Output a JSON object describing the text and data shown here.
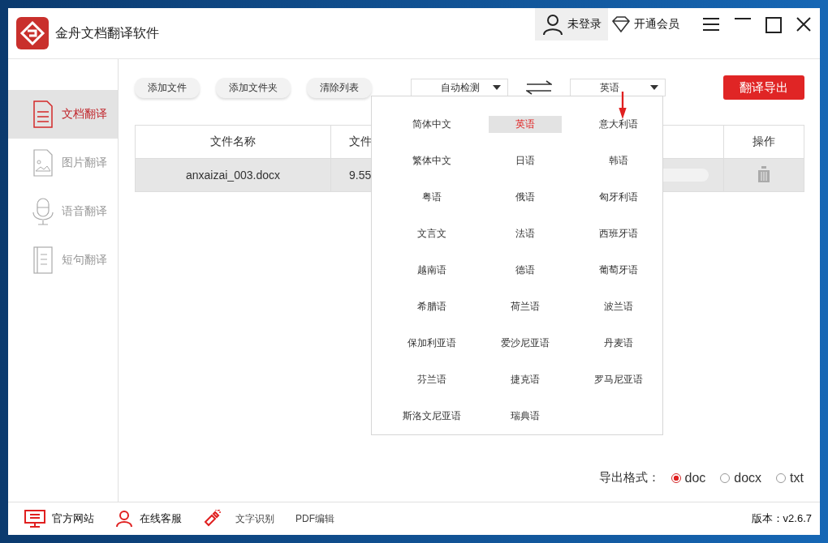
{
  "window": {
    "title": "金舟文档翻译软件"
  },
  "header": {
    "user": "未登录",
    "vip": "开通会员"
  },
  "sidebar": {
    "items": [
      {
        "label": "文档翻译",
        "kind": "doc",
        "selected": true
      },
      {
        "label": "图片翻译",
        "kind": "image",
        "selected": false
      },
      {
        "label": "语音翻译",
        "kind": "voice",
        "selected": false
      },
      {
        "label": "短句翻译",
        "kind": "sentence",
        "selected": false
      }
    ]
  },
  "toolbar": {
    "buttons": [
      "添加文件",
      "添加文件夹",
      "清除列表"
    ],
    "source_language": "自动检测",
    "target_language": "英语",
    "export_button": "翻译导出"
  },
  "table": {
    "columns": [
      "文件名称",
      "文件",
      "操作"
    ],
    "rows": [
      {
        "name": "anxaizai_003.docx",
        "size": "9.55"
      }
    ]
  },
  "language_menu": {
    "items": [
      {
        "label": "简体中文",
        "selected": false
      },
      {
        "label": "英语",
        "selected": true
      },
      {
        "label": "意大利语",
        "selected": false
      },
      {
        "label": "繁体中文",
        "selected": false
      },
      {
        "label": "日语",
        "selected": false
      },
      {
        "label": "韩语",
        "selected": false
      },
      {
        "label": "粤语",
        "selected": false
      },
      {
        "label": "俄语",
        "selected": false
      },
      {
        "label": "匈牙利语",
        "selected": false
      },
      {
        "label": "文言文",
        "selected": false
      },
      {
        "label": "法语",
        "selected": false
      },
      {
        "label": "西班牙语",
        "selected": false
      },
      {
        "label": "越南语",
        "selected": false
      },
      {
        "label": "德语",
        "selected": false
      },
      {
        "label": "葡萄牙语",
        "selected": false
      },
      {
        "label": "希腊语",
        "selected": false
      },
      {
        "label": "荷兰语",
        "selected": false
      },
      {
        "label": "波兰语",
        "selected": false
      },
      {
        "label": "保加利亚语",
        "selected": false
      },
      {
        "label": "爱沙尼亚语",
        "selected": false
      },
      {
        "label": "丹麦语",
        "selected": false
      },
      {
        "label": "芬兰语",
        "selected": false
      },
      {
        "label": "捷克语",
        "selected": false
      },
      {
        "label": "罗马尼亚语",
        "selected": false
      },
      {
        "label": "斯洛文尼亚语",
        "selected": false
      },
      {
        "label": "瑞典语",
        "selected": false
      }
    ]
  },
  "export_format": {
    "label": "导出格式：",
    "options": [
      {
        "label": "doc",
        "selected": true
      },
      {
        "label": "docx",
        "selected": false
      },
      {
        "label": "txt",
        "selected": false
      }
    ]
  },
  "footer": {
    "links": [
      {
        "label": "官方网站",
        "kind": "monitor"
      },
      {
        "label": "在线客服",
        "kind": "person"
      },
      {
        "label": "文字识别",
        "kind": "flashlight"
      },
      {
        "label": "PDF编辑",
        "kind": "none"
      }
    ],
    "version": "版本：v2.6.7"
  }
}
